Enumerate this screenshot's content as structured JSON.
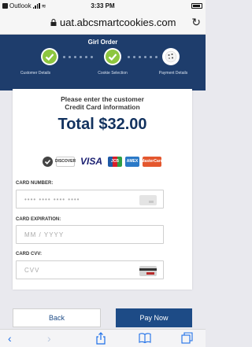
{
  "status_bar": {
    "app_back": "Outlook",
    "time": "3:33 PM"
  },
  "browser": {
    "url": "uat.abcsmartcookies.com"
  },
  "header": {
    "title": "Girl Order",
    "steps": [
      {
        "label": "Customer Details",
        "state": "done"
      },
      {
        "label": "Cookie Selection",
        "state": "done"
      },
      {
        "label": "Payment Details",
        "state": "current"
      }
    ]
  },
  "payment": {
    "prompt_line1": "Please enter the customer",
    "prompt_line2": "Credit Card information",
    "total": "Total $32.00",
    "card_brands": [
      "DISCOVER",
      "VISA",
      "JCB",
      "AMEX",
      "MasterCard"
    ],
    "fields": {
      "card_number": {
        "label": "CARD NUMBER:",
        "placeholder": "•••• •••• •••• ••••"
      },
      "expiration": {
        "label": "CARD EXPIRATION:",
        "placeholder": "MM / YYYY"
      },
      "cvv": {
        "label": "CARD CVV:",
        "placeholder": "CVV"
      }
    }
  },
  "actions": {
    "back_label": "Back",
    "pay_label": "Pay Now"
  },
  "colors": {
    "header_blue": "#1e3d6c",
    "accent_blue": "#1d4b86",
    "check_green": "#8dc63f"
  },
  "icons": {
    "toolbar": [
      "back-arrow-icon",
      "forward-arrow-icon",
      "share-icon",
      "bookmarks-icon",
      "tabs-icon"
    ]
  }
}
